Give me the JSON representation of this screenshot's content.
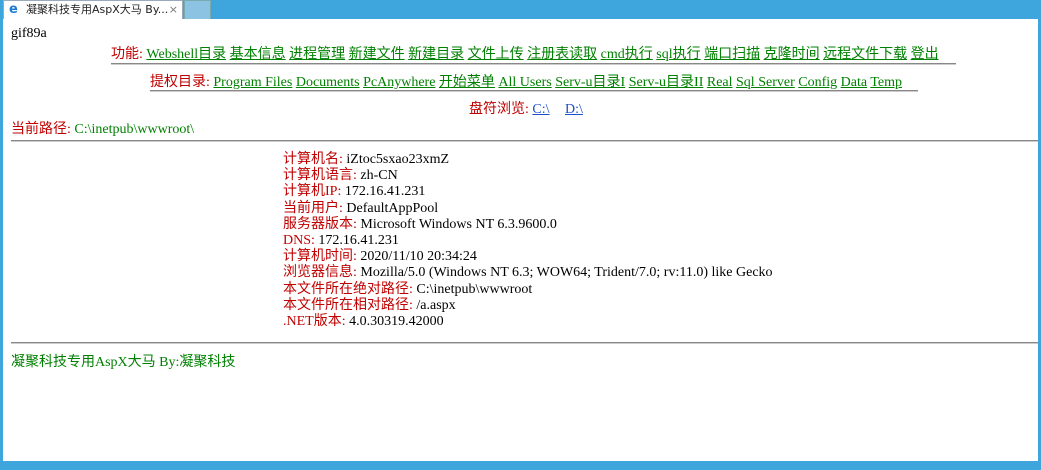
{
  "tab": {
    "title": "凝聚科技专用AspX大马 By...",
    "icon": "ie-icon",
    "close": "×"
  },
  "header_text": "gif89a",
  "functions": {
    "label": "功能:",
    "items": [
      "Webshell目录",
      "基本信息",
      "进程管理",
      "新建文件",
      "新建目录",
      "文件上传",
      "注册表读取",
      "cmd执行",
      "sql执行",
      "端口扫描",
      "克隆时间",
      "远程文件下载",
      "登出"
    ]
  },
  "privesc": {
    "label": "提权目录:",
    "items": [
      "Program Files",
      "Documents",
      "PcAnywhere",
      "开始菜单",
      "All Users",
      "Serv-u目录I",
      "Serv-u目录II",
      "Real",
      "Sql Server",
      "Config",
      "Data",
      "Temp"
    ]
  },
  "drives": {
    "label": "盘符浏览:",
    "items": [
      "C:\\",
      "D:\\"
    ]
  },
  "current_path": {
    "label": "当前路径:",
    "value": "C:\\inetpub\\wwwroot\\"
  },
  "info": [
    {
      "label": "计算机名:",
      "value": "iZtoc5sxao23xmZ"
    },
    {
      "label": "计算机语言:",
      "value": "zh-CN"
    },
    {
      "label": "计算机IP:",
      "value": "172.16.41.231"
    },
    {
      "label": "当前用户:",
      "value": "DefaultAppPool"
    },
    {
      "label": "服务器版本:",
      "value": "Microsoft Windows NT 6.3.9600.0"
    },
    {
      "label": "DNS:",
      "value": "172.16.41.231"
    },
    {
      "label": "计算机时间:",
      "value": "2020/11/10 20:34:24"
    },
    {
      "label": "浏览器信息:",
      "value": "Mozilla/5.0 (Windows NT 6.3; WOW64; Trident/7.0; rv:11.0) like Gecko"
    },
    {
      "label": "本文件所在绝对路径:",
      "value": "C:\\inetpub\\wwwroot"
    },
    {
      "label": "本文件所在相对路径:",
      "value": "/a.aspx"
    },
    {
      "label": ".NET版本:",
      "value": "4.0.30319.42000"
    }
  ],
  "footer": "凝聚科技专用AspX大马 By:凝聚科技"
}
